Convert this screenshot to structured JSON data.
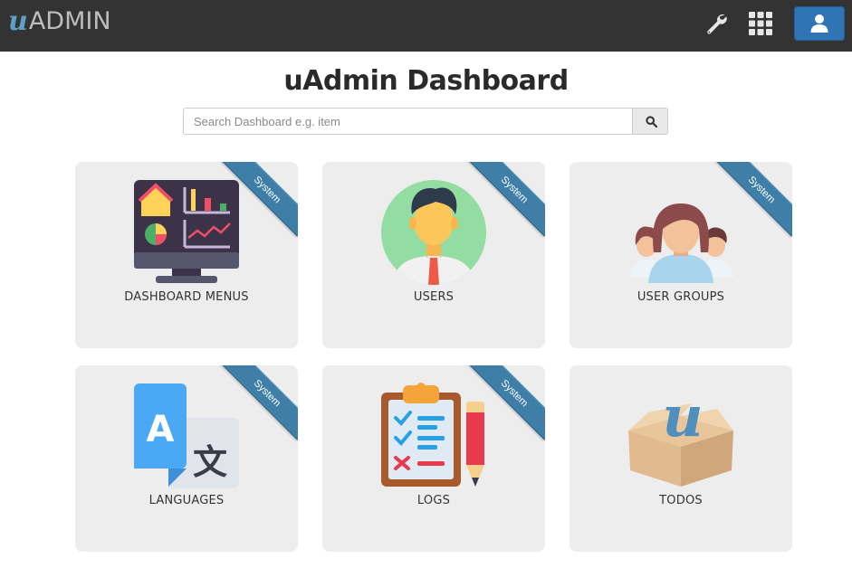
{
  "navbar": {
    "logo_u": "u",
    "logo_text": "ADMIN",
    "settings_icon": "wrench-icon",
    "apps_icon": "grid-icon",
    "account_icon": "user-icon"
  },
  "page": {
    "title": "uAdmin Dashboard"
  },
  "search": {
    "placeholder": "Search Dashboard e.g. item",
    "value": "",
    "button_icon": "search-icon"
  },
  "colors": {
    "navbar_bg": "#333333",
    "accent": "#2f74b4",
    "ribbon": "#3e7ea7",
    "card_bg": "#ededed"
  },
  "cards": [
    {
      "label": "DASHBOARD MENUS",
      "ribbon": "System",
      "icon": "dashboard-monitor-icon"
    },
    {
      "label": "USERS",
      "ribbon": "System",
      "icon": "user-avatar-icon"
    },
    {
      "label": "USER GROUPS",
      "ribbon": "System",
      "icon": "user-group-icon"
    },
    {
      "label": "LANGUAGES",
      "ribbon": "System",
      "icon": "translate-icon"
    },
    {
      "label": "LOGS",
      "ribbon": "System",
      "icon": "clipboard-checklist-icon"
    },
    {
      "label": "TODOS",
      "ribbon": "",
      "icon": "box-logo-icon"
    }
  ]
}
